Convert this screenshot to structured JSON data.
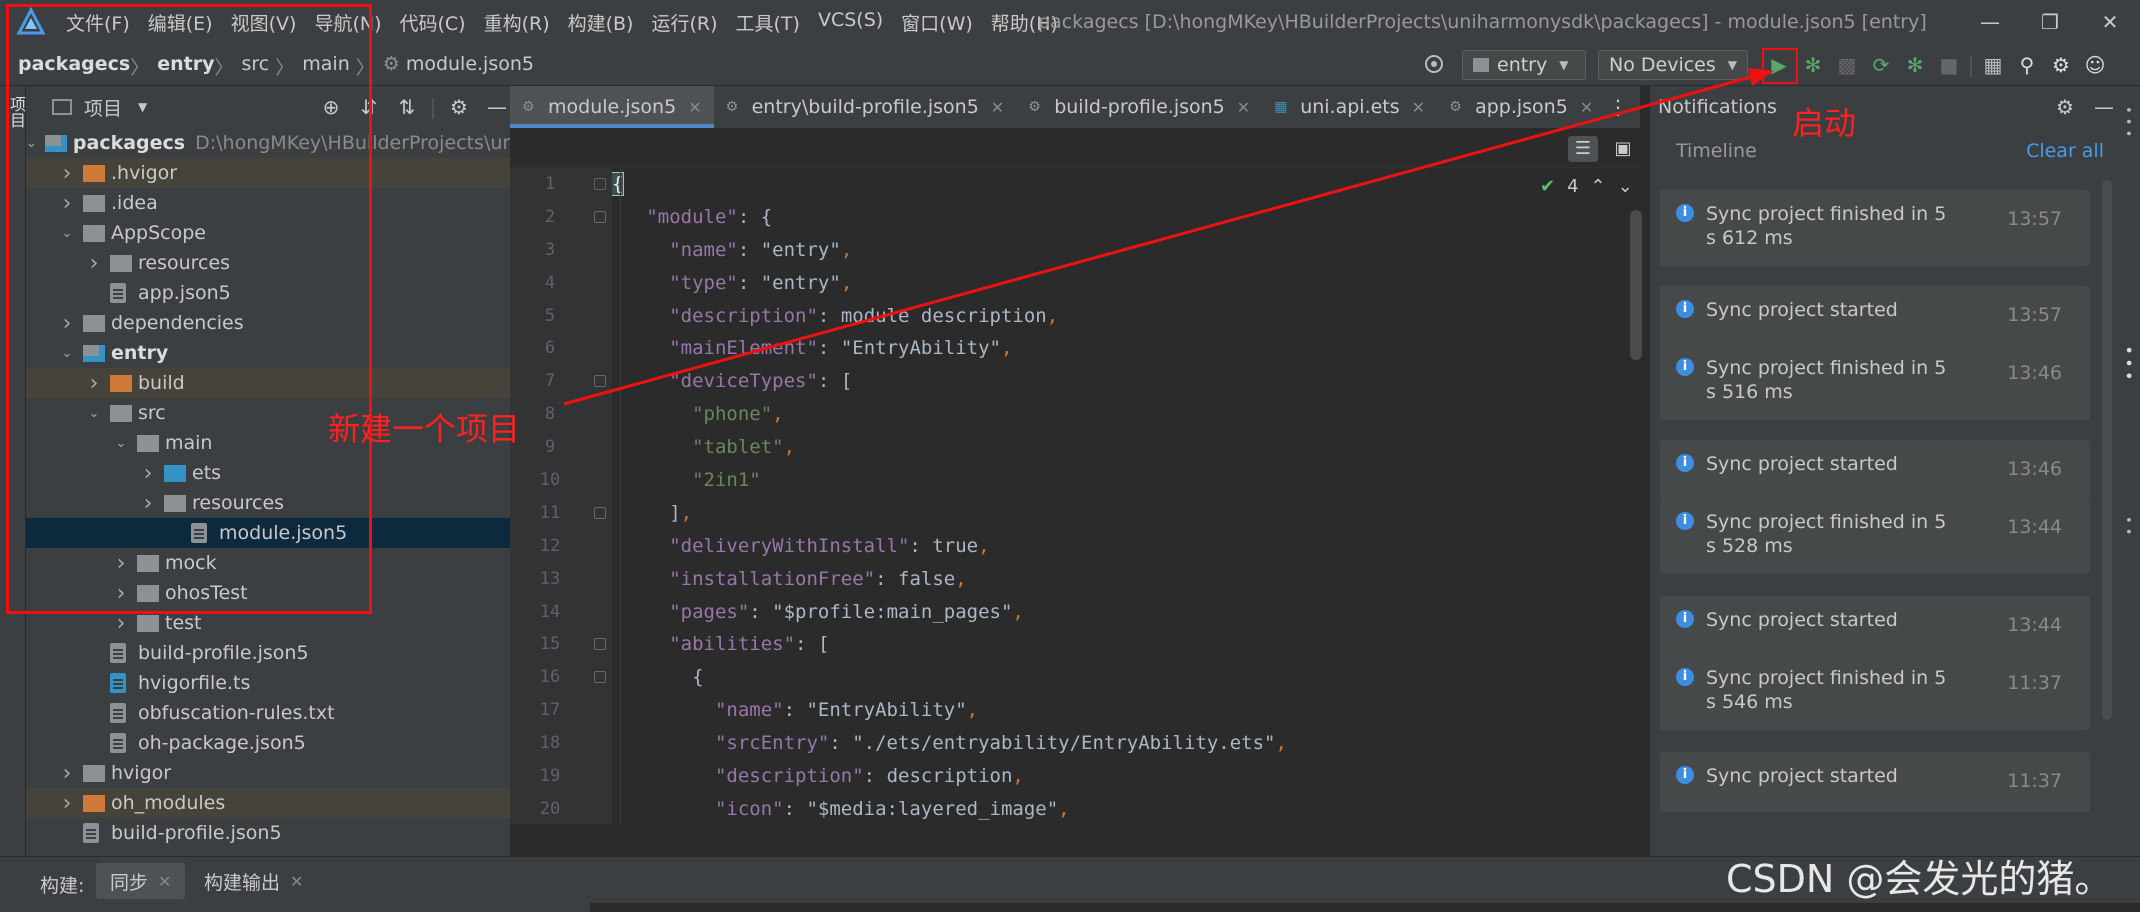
{
  "window": {
    "title": "packagecs [D:\\hongMKey\\HBuilderProjects\\uniharmonysdk\\packagecs] - module.json5 [entry]",
    "menu": [
      "文件(F)",
      "编辑(E)",
      "视图(V)",
      "导航(N)",
      "代码(C)",
      "重构(R)",
      "构建(B)",
      "运行(R)",
      "工具(T)",
      "VCS(S)",
      "窗口(W)",
      "帮助(H)"
    ]
  },
  "breadcrumb": [
    "packagecs",
    "entry",
    "src",
    "main",
    "module.json5"
  ],
  "toolbar": {
    "module": "entry",
    "devices": "No Devices"
  },
  "project_panel": {
    "title": "项目",
    "side_label": "项目",
    "tree": [
      {
        "label": "packagecs",
        "path": "D:\\hongMKey\\HBuilderProjects\\uni",
        "bold": true
      },
      {
        "label": ".hvigor"
      },
      {
        "label": ".idea"
      },
      {
        "label": "AppScope"
      },
      {
        "label": "resources"
      },
      {
        "label": "app.json5"
      },
      {
        "label": "dependencies"
      },
      {
        "label": "entry",
        "bold": true
      },
      {
        "label": "build"
      },
      {
        "label": "src"
      },
      {
        "label": "main"
      },
      {
        "label": "ets"
      },
      {
        "label": "resources"
      },
      {
        "label": "module.json5"
      },
      {
        "label": "mock"
      },
      {
        "label": "ohosTest"
      },
      {
        "label": "test"
      },
      {
        "label": "build-profile.json5"
      },
      {
        "label": "hvigorfile.ts"
      },
      {
        "label": "obfuscation-rules.txt"
      },
      {
        "label": "oh-package.json5"
      },
      {
        "label": "hvigor"
      },
      {
        "label": "oh_modules"
      },
      {
        "label": "build-profile.json5"
      }
    ]
  },
  "editor": {
    "tabs": [
      "module.json5",
      "entry\\build-profile.json5",
      "build-profile.json5",
      "uni.api.ets",
      "app.json5"
    ],
    "check_count": "4",
    "line_numbers": [
      "1",
      "2",
      "3",
      "4",
      "5",
      "6",
      "7",
      "8",
      "9",
      "10",
      "11",
      "12",
      "13",
      "14",
      "15",
      "16",
      "17",
      "18",
      "19",
      "20"
    ],
    "code": [
      "{",
      "\"module\": {",
      "\"name\": \"entry\",",
      "\"type\": \"entry\",",
      "\"description\": module description,",
      "\"mainElement\": \"EntryAbility\",",
      "\"deviceTypes\": [",
      "\"phone\",",
      "\"tablet\",",
      "\"2in1\"",
      "],",
      "\"deliveryWithInstall\": true,",
      "\"installationFree\": false,",
      "\"pages\": \"$profile:main_pages\",",
      "\"abilities\": [",
      "{",
      "\"name\": \"EntryAbility\",",
      "\"srcEntry\": \"./ets/entryability/EntryAbility.ets\",",
      "\"description\": description,",
      "\"icon\": \"$media:layered_image\","
    ]
  },
  "notifications": {
    "title": "Notifications",
    "timeline": "Timeline",
    "clear_all": "Clear all",
    "items": [
      {
        "message": "Sync project finished in 5 s 612 ms",
        "time": "13:57"
      },
      {
        "message": "Sync project started",
        "time": "13:57"
      },
      {
        "message": "Sync project finished in 5 s 516 ms",
        "time": "13:46"
      },
      {
        "message": "Sync project started",
        "time": "13:46"
      },
      {
        "message": "Sync project finished in 5 s 528 ms",
        "time": "13:44"
      },
      {
        "message": "Sync project started",
        "time": "13:44"
      },
      {
        "message": "Sync project finished in 5 s 546 ms",
        "time": "11:37"
      },
      {
        "message": "Sync project started",
        "time": "11:37"
      }
    ]
  },
  "bottom": {
    "label": "构建:",
    "tabs": [
      "同步",
      "构建输出"
    ]
  },
  "annotations": {
    "new_project": "新建一个项目",
    "launch": "启动"
  },
  "watermark": "CSDN @会发光的猪。",
  "colors": {
    "annotation": "#ee1111",
    "run": "#59a869",
    "link": "#4a9ae9"
  }
}
